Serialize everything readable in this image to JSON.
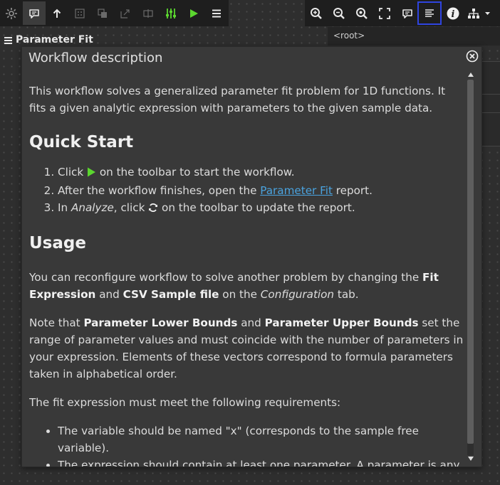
{
  "toolbar": {
    "left": [
      {
        "name": "settings-gear-icon",
        "state": "normal"
      },
      {
        "name": "comment-icon",
        "state": "active"
      },
      {
        "name": "arrow-up-icon",
        "state": "normal"
      },
      {
        "name": "grid-dots-icon",
        "state": "disabled"
      },
      {
        "name": "layers-icon",
        "state": "disabled"
      },
      {
        "name": "export-icon",
        "state": "disabled"
      },
      {
        "name": "split-icon",
        "state": "disabled"
      },
      {
        "name": "sliders-icon",
        "state": "accent"
      },
      {
        "name": "play-icon",
        "state": "accent"
      },
      {
        "name": "menu-icon",
        "state": "normal"
      }
    ],
    "right": [
      {
        "name": "zoom-in-icon"
      },
      {
        "name": "zoom-out-icon"
      },
      {
        "name": "zoom-fit-icon"
      },
      {
        "name": "fullscreen-icon"
      },
      {
        "name": "comment-icon"
      },
      {
        "name": "description-icon",
        "selected": true
      },
      {
        "name": "info-icon"
      },
      {
        "name": "hierarchy-dropdown-icon"
      }
    ],
    "accent_color": "#5bd62f",
    "selection_color": "#2f44e0"
  },
  "panel": {
    "title": "Parameter Fit",
    "root_label": "<root>"
  },
  "dialog": {
    "title": "Workflow description",
    "intro": "This workflow solves a generalized parameter fit problem for 1D functions. It fits a given analytic expression with parameters to the given sample data.",
    "quick_start": {
      "heading": "Quick Start",
      "step1_a": "Click ",
      "step1_b": " on the toolbar to start the workflow.",
      "step2_a": "After the workflow finishes, open the ",
      "step2_link": "Parameter Fit",
      "step2_b": " report.",
      "step3_a": "In ",
      "step3_em": "Analyze",
      "step3_b": ", click ",
      "step3_c": " on the toolbar to update the report."
    },
    "usage": {
      "heading": "Usage",
      "p1_a": "You can reconfigure workflow to solve another problem by changing the ",
      "p1_b1": "Fit Expression",
      "p1_c": " and ",
      "p1_b2": "CSV Sample file",
      "p1_d": " on the ",
      "p1_em": "Configuration",
      "p1_e": " tab.",
      "p2_a": "Note that ",
      "p2_b1": "Parameter Lower Bounds",
      "p2_c": " and ",
      "p2_b2": "Parameter Upper Bounds",
      "p2_d": " set the range of parameter values and must coincide with the number of parameters in your expression. Elements of these vectors correspond to formula parameters taken in alphabetical order.",
      "p3": "The fit expression must meet the following requirements:",
      "bullet1": "The variable should be named \"x\" (corresponds to the sample free variable).",
      "bullet2": "The expression should contain at least one parameter. A parameter is any"
    }
  }
}
